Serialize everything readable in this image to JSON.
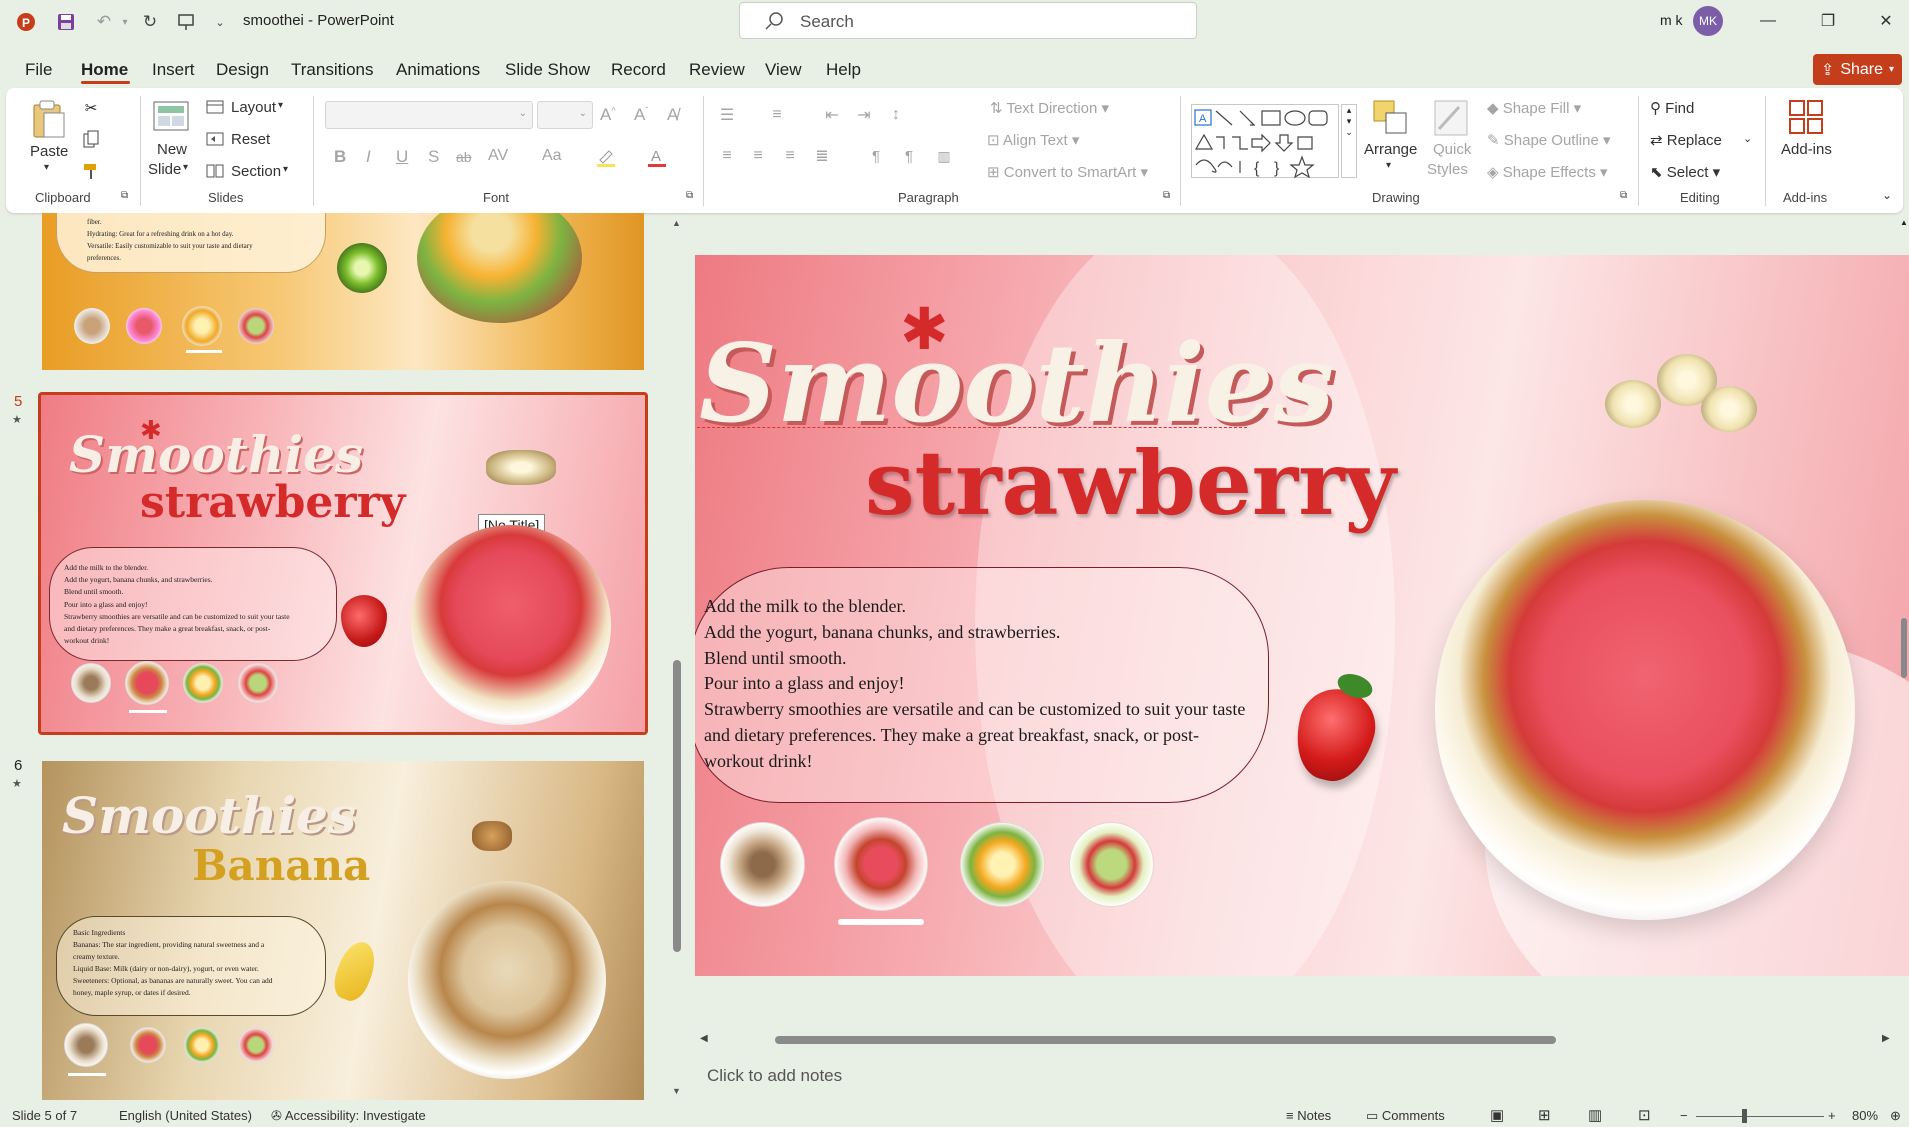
{
  "window": {
    "app_title": "smoothei  -  PowerPoint",
    "search_placeholder": "Search",
    "user_name": "m k",
    "user_initials": "MK",
    "accent": "#c43e1c"
  },
  "menu": {
    "tabs": [
      "File",
      "Home",
      "Insert",
      "Design",
      "Transitions",
      "Animations",
      "Slide Show",
      "Record",
      "Review",
      "View",
      "Help"
    ],
    "active": "Home",
    "share_label": "Share"
  },
  "ribbon": {
    "clipboard": {
      "paste": "Paste",
      "group": "Clipboard"
    },
    "slides": {
      "new_slide_line1": "New",
      "new_slide_line2": "Slide",
      "layout": "Layout",
      "reset": "Reset",
      "section": "Section",
      "group": "Slides"
    },
    "font": {
      "group": "Font",
      "bold": "B",
      "italic": "I",
      "underline": "U",
      "shadow": "S",
      "strike": "ab",
      "spacing": "AV",
      "case": "Aa"
    },
    "paragraph": {
      "text_direction": "Text Direction",
      "align_text": "Align Text",
      "convert_smartart": "Convert to SmartArt",
      "group": "Paragraph"
    },
    "drawing": {
      "arrange": "Arrange",
      "quick_styles_1": "Quick",
      "quick_styles_2": "Styles",
      "shape_fill": "Shape Fill",
      "shape_outline": "Shape Outline",
      "shape_effects": "Shape Effects",
      "group": "Drawing"
    },
    "editing": {
      "find": "Find",
      "replace": "Replace",
      "select": "Select",
      "group": "Editing"
    },
    "addins": {
      "label": "Add-ins",
      "group": "Add-ins"
    }
  },
  "thumbnails": {
    "slide4": {
      "lines": [
        "fiber.",
        "Hydrating: Great for a refreshing drink on a hot day.",
        "Versatile: Easily customizable to suit your taste and dietary",
        "preferences."
      ]
    },
    "slide5": {
      "number": "5",
      "tooltip": "[No Title]",
      "title1": "Smoothies",
      "title2": "strawberry",
      "lines": [
        "Add the milk to the blender.",
        "Add the yogurt, banana chunks, and strawberries.",
        "Blend until smooth.",
        "Pour into a glass and enjoy!",
        "Strawberry smoothies are versatile and can be customized to suit your taste",
        "and dietary preferences. They make a great breakfast, snack, or post-",
        "workout drink!"
      ]
    },
    "slide6": {
      "number": "6",
      "title1": "Smoothies",
      "title2": "Banana",
      "lines": [
        "Basic Ingredients",
        "Bananas: The star ingredient, providing natural sweetness and a",
        "creamy texture.",
        "Liquid Base: Milk (dairy or non-dairy), yogurt, or even water.",
        "Sweeteners: Optional, as bananas are naturally sweet. You can add",
        "honey, maple syrup, or dates if desired."
      ]
    }
  },
  "main_slide": {
    "title1": "Smoothies",
    "title2": "strawberry",
    "lines": [
      "Add the milk to the blender.",
      "Add the yogurt, banana chunks, and strawberries.",
      "Blend until smooth.",
      "Pour into a glass and enjoy!",
      "Strawberry smoothies are versatile and can be customized to suit your taste",
      "and dietary preferences. They make a great breakfast, snack, or post-",
      "workout drink!"
    ],
    "title2_color": "#d42a2a"
  },
  "notes_placeholder": "Click to add notes",
  "status": {
    "slide_count": "Slide 5 of 7",
    "language": "English (United States)",
    "accessibility": "Accessibility: Investigate",
    "notes": "Notes",
    "comments": "Comments",
    "zoom": "80%"
  }
}
